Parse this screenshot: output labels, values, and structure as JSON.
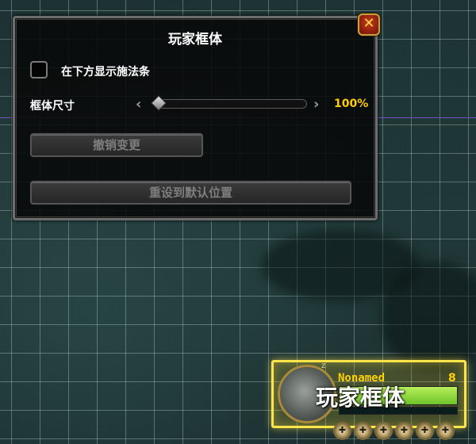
{
  "panel": {
    "title": "玩家框体",
    "close_icon": "close-x-icon",
    "show_castbar_label": "在下方显示施法条",
    "show_castbar_checked": false,
    "frame_size_label": "框体尺寸",
    "frame_size_value": "100%",
    "frame_size_fraction": 0.0,
    "undo_button_label": "撤销变更",
    "reset_button_label": "重设到默认位置"
  },
  "player_frame": {
    "title_overlay": "玩家框体",
    "name": "Nonamed",
    "level": "8",
    "rest_indicator": "z",
    "health_fraction": 1.0,
    "aura_icons": [
      "aura-icon",
      "aura-icon",
      "aura-icon",
      "aura-icon",
      "aura-icon",
      "aura-icon"
    ]
  },
  "colors": {
    "accent_gold": "#ffcc00",
    "frame_highlight": "#ffe44a",
    "health_green": "#8fd63c",
    "guide_line": "#7a4fbf"
  }
}
